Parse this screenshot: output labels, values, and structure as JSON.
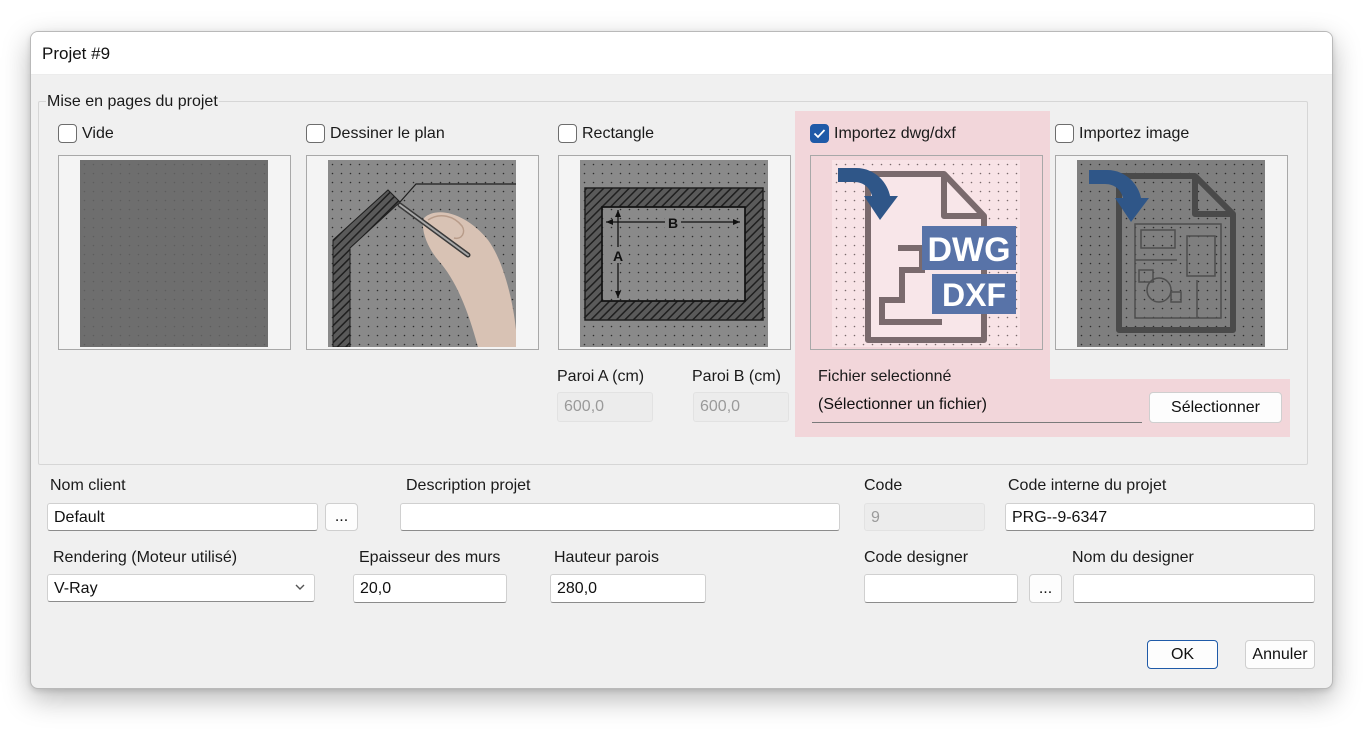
{
  "window": {
    "title": "Projet #9"
  },
  "layout_group": {
    "legend": "Mise en pages du projet",
    "options": [
      {
        "label": "Vide",
        "checked": false,
        "image": "empty-grid-icon"
      },
      {
        "label": "Dessiner le plan",
        "checked": false,
        "image": "hand-drawing-plan-icon"
      },
      {
        "label": "Rectangle",
        "checked": false,
        "image": "rectangle-walls-icon",
        "image_labels": {
          "a": "A",
          "b": "B"
        }
      },
      {
        "label": "Importez dwg/dxf",
        "checked": true,
        "image": "dwg-dxf-file-icon",
        "image_labels": {
          "dwg": "DWG",
          "dxf": "DXF"
        }
      },
      {
        "label": "Importez image",
        "checked": false,
        "image": "import-image-icon"
      }
    ],
    "wall_a": {
      "label": "Paroi A (cm)",
      "value": "600,0"
    },
    "wall_b": {
      "label": "Paroi B (cm)",
      "value": "600,0"
    },
    "file": {
      "label": "Fichier selectionné",
      "value": "(Sélectionner un fichier)",
      "button": "Sélectionner"
    }
  },
  "client": {
    "label": "Nom client",
    "value": "Default",
    "browse": "..."
  },
  "description": {
    "label": "Description projet",
    "value": ""
  },
  "code": {
    "label": "Code",
    "value": "9"
  },
  "internal_code": {
    "label": "Code interne du projet",
    "value": "PRG--9-6347"
  },
  "rendering": {
    "label": "Rendering (Moteur utilisé)",
    "value": "V-Ray"
  },
  "wall_thickness": {
    "label": "Epaisseur des murs",
    "value": "20,0"
  },
  "wall_height": {
    "label": "Hauteur parois",
    "value": "280,0"
  },
  "designer_code": {
    "label": "Code designer",
    "value": "",
    "browse": "..."
  },
  "designer_name": {
    "label": "Nom du designer",
    "value": ""
  },
  "actions": {
    "ok": "OK",
    "cancel": "Annuler"
  },
  "colors": {
    "accent": "#1f5aa8",
    "highlight": "#f2d6da",
    "dwg_blue": "#5873a8",
    "arrow_blue": "#2f5688"
  }
}
